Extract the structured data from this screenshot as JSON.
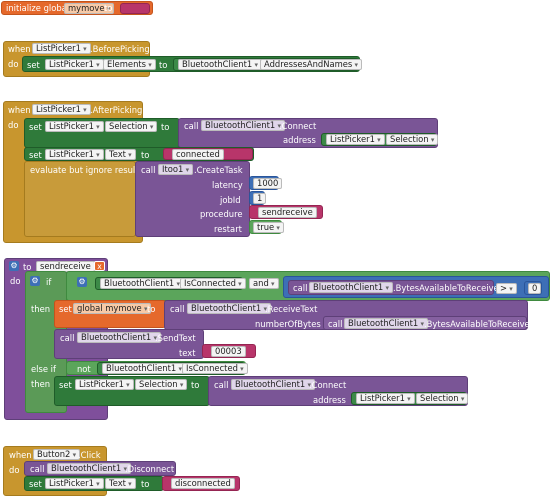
{
  "blocks": {
    "init": {
      "label": "initialize global",
      "var": "mymove",
      "to": "to"
    },
    "before": {
      "when": "when",
      "component": "ListPicker1",
      "event": ".BeforePicking",
      "do": "do",
      "set": "set",
      "target": "ListPicker1",
      "prop": "Elements",
      "to": "to",
      "src": "BluetoothClient1",
      "srcprop": "AddressesAndNames"
    },
    "after": {
      "when": "when",
      "component": "ListPicker1",
      "event": ".AfterPicking",
      "do": "do",
      "set1": "set",
      "t1": "ListPicker1",
      "p1": "Selection",
      "to1": "to",
      "call1": "call",
      "c1": "BluetoothClient1",
      "m1": ".Connect",
      "addr_lbl": "address",
      "addr_comp": "ListPicker1",
      "addr_prop": "Selection",
      "set2": "set",
      "t2": "ListPicker1",
      "p2": "Text",
      "to2": "to",
      "v2": "connected",
      "eval": "evaluate but ignore result",
      "call2": "call",
      "c2": "Itoo1",
      "m2": ".CreateTask",
      "latency_lbl": "latency",
      "latency": "1000",
      "jobid_lbl": "jobId",
      "jobid": "1",
      "procedure_lbl": "procedure",
      "procedure": "sendreceive",
      "restart_lbl": "restart",
      "restart": "true"
    },
    "proc": {
      "to": "to",
      "name": "sendreceive",
      "do": "do",
      "if": "if",
      "and": "and",
      "c_isconn": "BluetoothClient1",
      "isconn": "IsConnected",
      "call_bytes": "call",
      "c_bytes": "BluetoothClient1",
      "bytes": ".BytesAvailableToReceive",
      "gt": ">",
      "zero": "0",
      "then": "then",
      "set": "set",
      "gvar": "global mymove",
      "to2": "to",
      "call_rt": "call",
      "c_rt": "BluetoothClient1",
      "rt": ".ReceiveText",
      "nob_lbl": "numberOfBytes",
      "call_nb": "call",
      "c_nb": "BluetoothClient1",
      "nb": ".BytesAvailableToReceive",
      "call_st": "call",
      "c_st": "BluetoothClient1",
      "st": ".SendText",
      "text_lbl": "text",
      "text_val": "00003",
      "elseif": "else if",
      "not": "not",
      "c_not": "BluetoothClient1",
      "notprop": "IsConnected",
      "then2": "then",
      "set2": "set",
      "t_set2": "ListPicker1",
      "p_set2": "Selection",
      "to3": "to",
      "call_c": "call",
      "c_c": "BluetoothClient1",
      "m_c": ".Connect",
      "addr_lbl": "address",
      "addr_comp": "ListPicker1",
      "addr_prop": "Selection"
    },
    "click": {
      "when": "when",
      "component": "Button2",
      "event": ".Click",
      "do": "do",
      "call": "call",
      "c": "BluetoothClient1",
      "m": ".Disconnect",
      "set": "set",
      "t": "ListPicker1",
      "p": "Text",
      "to": "to",
      "v": "disconnected"
    }
  }
}
